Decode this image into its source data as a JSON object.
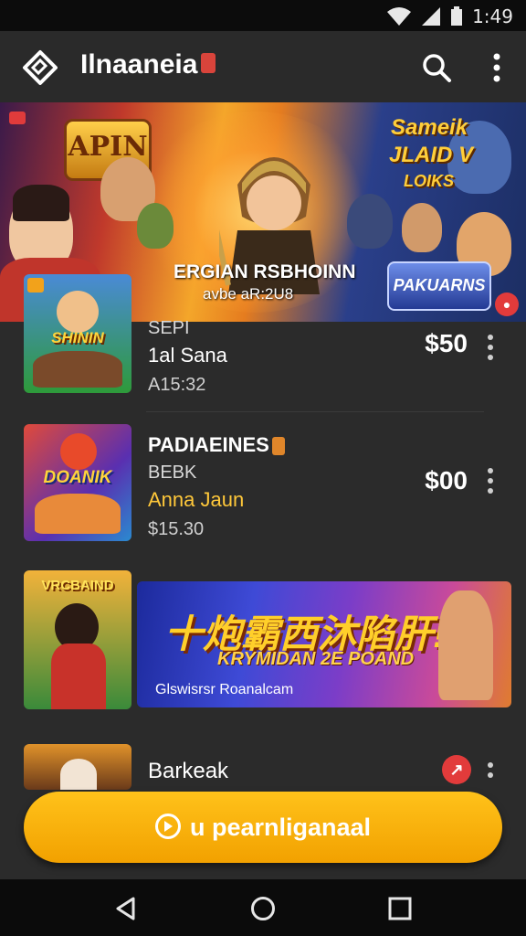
{
  "status": {
    "time": "1:49"
  },
  "appbar": {
    "title": "Ilnaaneia"
  },
  "banner": {
    "logo_left": "APIN",
    "right_text_1": "Sameik",
    "right_text_2": "JLAID V",
    "right_text_3": "LOIKS",
    "caption_title": "ERGIAN RSBHOINN",
    "caption_sub": "avbe aR:2U8",
    "brand": "PAKUARNS"
  },
  "list": [
    {
      "line1": "SEPI",
      "line2": "1al Sana",
      "line3": "A15:32",
      "price": "$50",
      "thumb_label": "SHININ"
    },
    {
      "line1": "PADIAEINES",
      "line2": "BEBK",
      "line3": "Anna Jaun",
      "line4": "$15.30",
      "price": "$00",
      "thumb_label": "DOANIK"
    }
  ],
  "promo": {
    "thumb_label": "VRCBAIND",
    "headline": "十炮霸西沐陷肝!",
    "subline": "KRYMIDAN 2E POAND",
    "footer": "Glswisrsr Roanalcam"
  },
  "partial_item": {
    "title": "Barkeak"
  },
  "cta": {
    "label": "u pearnliganaal"
  },
  "colors": {
    "accent": "#ffc21a",
    "background": "#2b2b2b",
    "badge": "#e23b3b"
  }
}
